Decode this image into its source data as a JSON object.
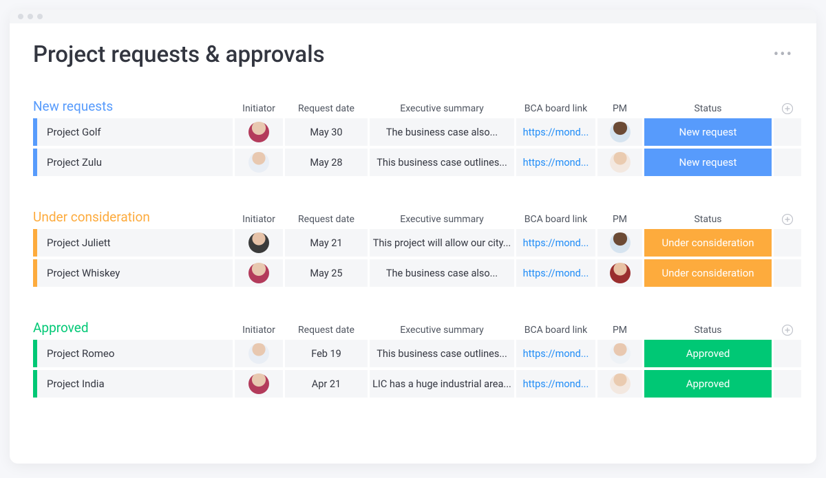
{
  "title": "Project requests & approvals",
  "columns": {
    "initiator": "Initiator",
    "request_date": "Request date",
    "exec_summary": "Executive summary",
    "bca_link": "BCA board link",
    "pm": "PM",
    "status": "Status"
  },
  "status_colors": {
    "new": "#579bfc",
    "consideration": "#fdab3d",
    "approved": "#00c875"
  },
  "groups": [
    {
      "name": "New requests",
      "color_class": "g-blue",
      "rows": [
        {
          "name": "Project Golf",
          "initiator_avatar": "av1",
          "date": "May 30",
          "summary": "The business case also...",
          "link": "https://mond...",
          "pm_avatar": "av3",
          "status_label": "New request",
          "status_class": "st-new"
        },
        {
          "name": "Project Zulu",
          "initiator_avatar": "av2",
          "date": "May 28",
          "summary": "This business case outlines...",
          "link": "https://mond...",
          "pm_avatar": "av4",
          "status_label": "New request",
          "status_class": "st-new"
        }
      ]
    },
    {
      "name": "Under consideration",
      "color_class": "g-orange",
      "rows": [
        {
          "name": "Project Juliett",
          "initiator_avatar": "av5",
          "date": "May 21",
          "summary": "This project will allow our city...",
          "link": "https://mond...",
          "pm_avatar": "av3",
          "status_label": "Under consideration",
          "status_class": "st-cons"
        },
        {
          "name": "Project Whiskey",
          "initiator_avatar": "av1",
          "date": "May 25",
          "summary": "The business case also...",
          "link": "https://mond...",
          "pm_avatar": "av6",
          "status_label": "Under consideration",
          "status_class": "st-cons"
        }
      ]
    },
    {
      "name": "Approved",
      "color_class": "g-green",
      "rows": [
        {
          "name": "Project Romeo",
          "initiator_avatar": "av2",
          "date": "Feb 19",
          "summary": "This business case outlines...",
          "link": "https://mond...",
          "pm_avatar": "av7",
          "status_label": "Approved",
          "status_class": "st-apprv"
        },
        {
          "name": "Project India",
          "initiator_avatar": "av1",
          "date": "Apr 21",
          "summary": "LIC has a huge industrial area...",
          "link": "https://mond...",
          "pm_avatar": "av4",
          "status_label": "Approved",
          "status_class": "st-apprv"
        }
      ]
    }
  ]
}
